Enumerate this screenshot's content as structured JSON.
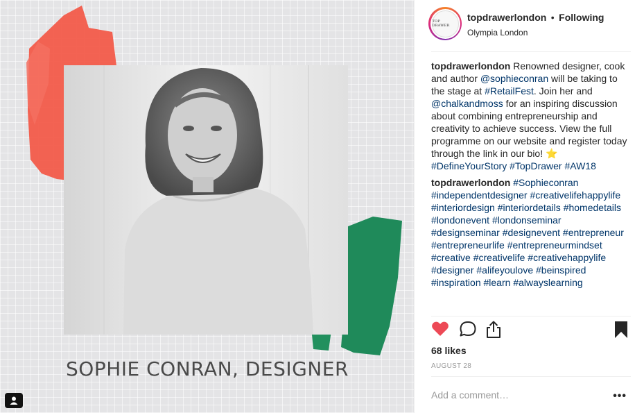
{
  "post": {
    "image_caption": "SOPHIE CONRAN, DESIGNER"
  },
  "header": {
    "avatar_text": "TOP DRAWER",
    "username": "topdrawerlondon",
    "separator": "•",
    "follow_state": "Following",
    "location": "Olympia London"
  },
  "caption": {
    "user": "topdrawerlondon",
    "text_1": " Renowned designer, cook and author ",
    "mention_1": "@sophieconran",
    "text_2": " will be taking to the stage at ",
    "hashtag_1": "#RetailFest",
    "text_3": ". Join her and ",
    "mention_2": "@chalkandmoss",
    "text_4": " for an inspiring discussion about combining entrepreneurship and creativity to achieve success. View the full programme on our website and register today through the link in our bio! ",
    "emoji": "⭐",
    "hashtag_2": "#DefineYourStory",
    "hashtag_3": "#TopDrawer",
    "hashtag_4": "#AW18"
  },
  "comment_1": {
    "user": "topdrawerlondon",
    "hashtags": [
      "#Sophieconran",
      "#independentdesigner",
      "#creativelifehappylife",
      "#interiordesign",
      "#interiordetails",
      "#homedetails",
      "#londonevent",
      "#londonseminar",
      "#designseminar",
      "#designevent",
      "#entrepreneur",
      "#entrepreneurlife",
      "#entrepreneurmindset",
      "#creative",
      "#creativelife",
      "#creativehappylife",
      "#designer",
      "#alifeyoulove",
      "#beinspired",
      "#inspiration",
      "#learn",
      "#alwayslearning"
    ]
  },
  "stats": {
    "likes": "68 likes",
    "date": "AUGUST 28"
  },
  "comment_box": {
    "placeholder": "Add a comment…",
    "more_label": "•••"
  },
  "icons": {
    "like": "heart-icon",
    "comment": "speech-bubble-icon",
    "share": "share-icon",
    "save": "bookmark-icon",
    "tag_people": "person-tag-icon"
  },
  "colors": {
    "like_active": "#ed4956",
    "link": "#003569",
    "meta_gray": "#999999",
    "brush_red": "#f25b4a",
    "brush_green": "#1f8a5a"
  }
}
